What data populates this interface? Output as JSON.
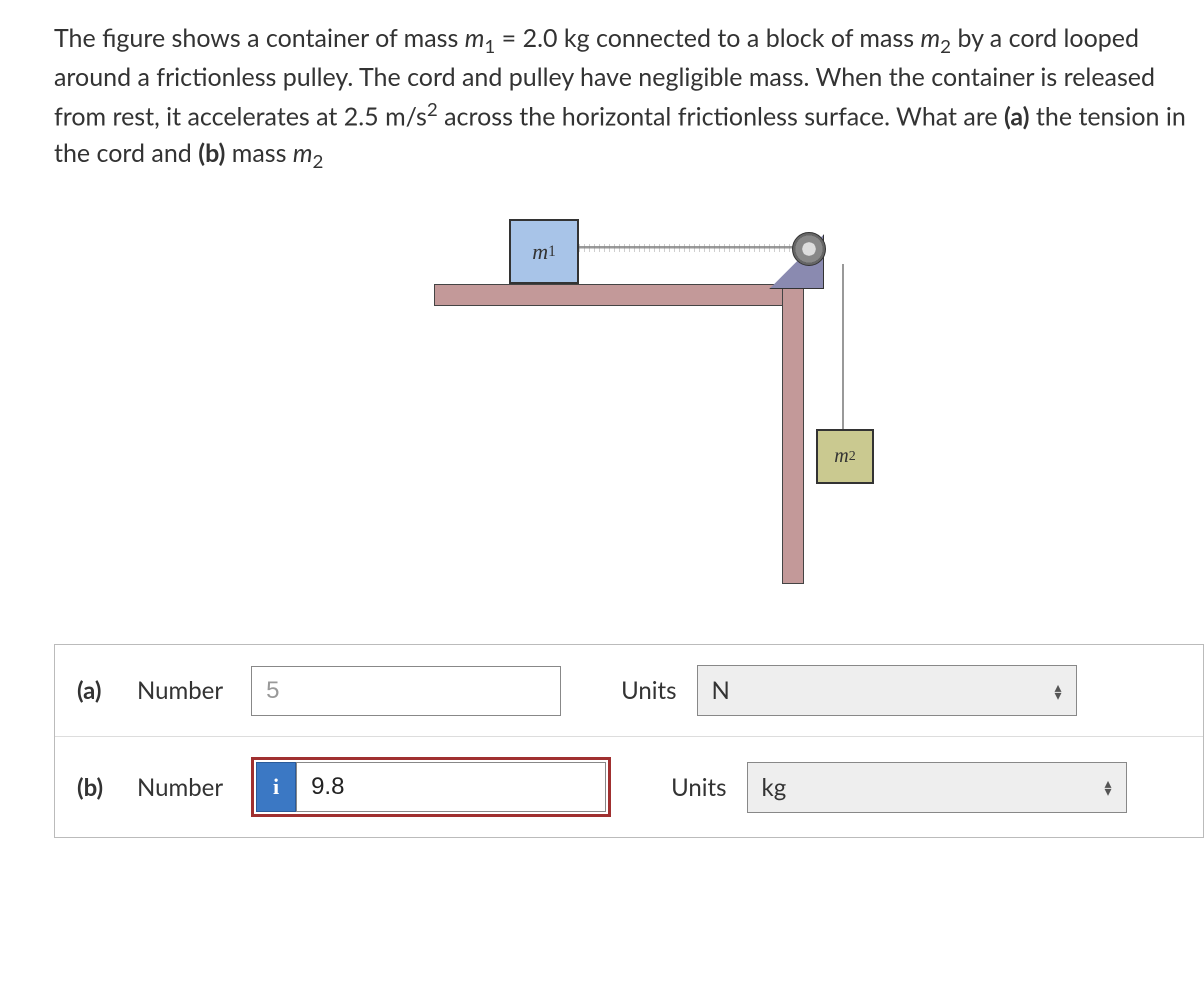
{
  "problem": {
    "text_html": "The figure shows a container of mass <i>m</i><sub>1</sub> = 2.0 kg connected to a block of mass <i>m</i><sub>2</sub> by a cord looped around a frictionless pulley. The cord and pulley have negligible mass. When the container is released from rest, it accelerates at 2.5 m/s<sup>2</sup> across the horizontal frictionless surface. What are <b>(a)</b> the tension in the cord and <b>(b)</b> mass <i>m</i><sub>2</sub>"
  },
  "figure": {
    "m1_label_html": "<i>m</i><sub>1</sub>",
    "m2_label_html": "<i>m</i><sub>2</sub>"
  },
  "answers": {
    "a": {
      "part": "(a)",
      "number_label": "Number",
      "value": "5",
      "units_label": "Units",
      "units_value": "N"
    },
    "b": {
      "part": "(b)",
      "number_label": "Number",
      "info_badge": "i",
      "value": "9.8",
      "units_label": "Units",
      "units_value": "kg"
    }
  }
}
